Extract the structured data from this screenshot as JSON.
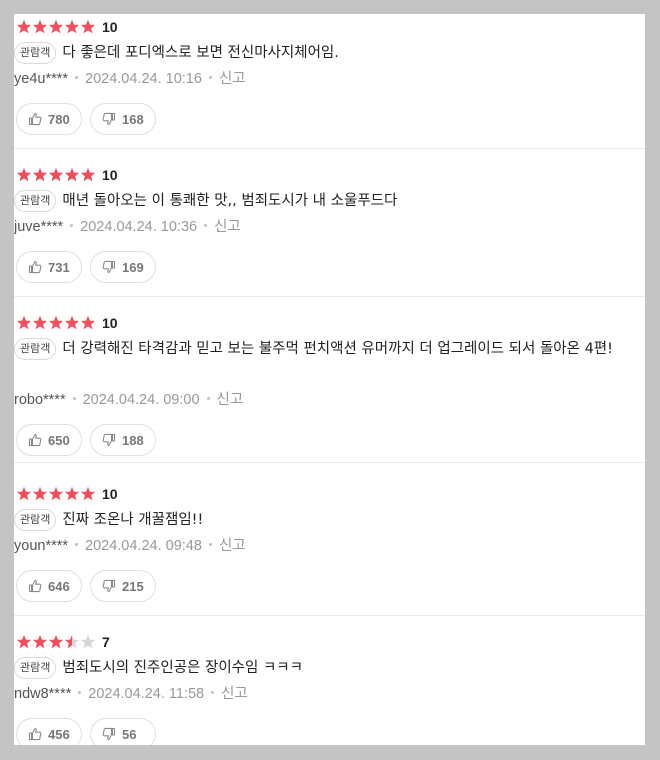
{
  "colors": {
    "star_filled": "#ee4e5e",
    "star_empty": "#d6d6d6",
    "page_bg": "#c4c4c4"
  },
  "icons": {
    "like": "thumbs-up-icon",
    "dislike": "thumbs-down-icon",
    "star": "star-icon"
  },
  "reviews": [
    {
      "stars": 5,
      "score": "10",
      "badge": "관람객",
      "text": "다 좋은데 포디엑스로 보면 전신마사지체어임.",
      "user": "ye4u****",
      "date": "2024.04.24. 10:16",
      "report": "신고",
      "likes": "780",
      "dislikes": "168"
    },
    {
      "stars": 5,
      "score": "10",
      "badge": "관람객",
      "text": "매년 돌아오는 이 통쾌한 맛,, 범죄도시가 내 소울푸드다",
      "user": "juve****",
      "date": "2024.04.24. 10:36",
      "report": "신고",
      "likes": "731",
      "dislikes": "169"
    },
    {
      "stars": 5,
      "score": "10",
      "badge": "관람객",
      "text": "더 강력해진 타격감과 믿고 보는 불주먹 펀치액션 유머까지 더 업그레이드 되서 돌아온 4편!",
      "user": "robo****",
      "date": "2024.04.24. 09:00",
      "report": "신고",
      "likes": "650",
      "dislikes": "188"
    },
    {
      "stars": 5,
      "score": "10",
      "badge": "관람객",
      "text": "진짜 조온나 개꿀잼임!!",
      "user": "youn****",
      "date": "2024.04.24. 09:48",
      "report": "신고",
      "likes": "646",
      "dislikes": "215"
    },
    {
      "stars": 3.5,
      "score": "7",
      "badge": "관람객",
      "text": "범죄도시의 진주인공은 장이수임 ㅋㅋㅋ",
      "user": "ndw8****",
      "date": "2024.04.24. 11:58",
      "report": "신고",
      "likes": "456",
      "dislikes": "56"
    }
  ]
}
